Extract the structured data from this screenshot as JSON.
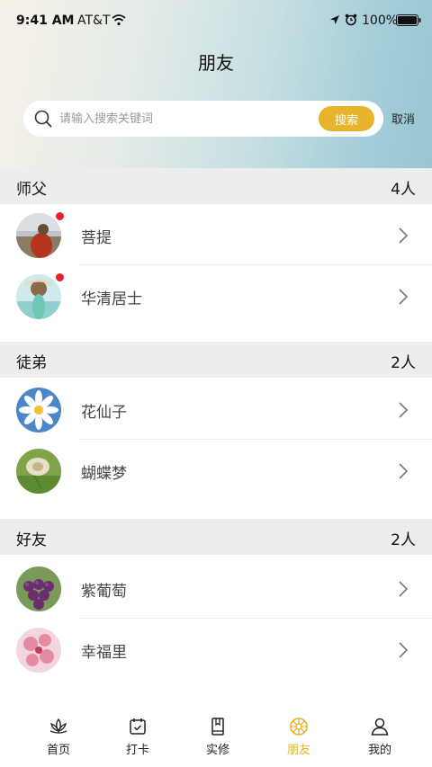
{
  "status_bar": {
    "time": "9:41 AM",
    "carrier": "AT&T",
    "battery": "100%"
  },
  "header": {
    "title": "朋友"
  },
  "search": {
    "placeholder": "请输入搜索关键词",
    "button_label": "搜索",
    "cancel_label": "取消"
  },
  "sections": [
    {
      "title": "师父",
      "count": "4人",
      "items": [
        {
          "name": "菩提",
          "unread": true
        },
        {
          "name": "华清居士",
          "unread": true
        }
      ]
    },
    {
      "title": "徒弟",
      "count": "2人",
      "items": [
        {
          "name": "花仙子",
          "unread": false
        },
        {
          "name": "蝴蝶梦",
          "unread": false
        }
      ]
    },
    {
      "title": "好友",
      "count": "2人",
      "items": [
        {
          "name": "紫葡萄",
          "unread": false
        },
        {
          "name": "幸福里",
          "unread": false
        }
      ]
    }
  ],
  "tab_bar": {
    "tabs": [
      {
        "label": "首页",
        "icon": "lotus-icon"
      },
      {
        "label": "打卡",
        "icon": "calendar-check-icon"
      },
      {
        "label": "实修",
        "icon": "book-icon"
      },
      {
        "label": "朋友",
        "icon": "dharma-wheel-icon",
        "active": true
      },
      {
        "label": "我的",
        "icon": "user-icon"
      }
    ]
  },
  "colors": {
    "accent": "#e6b52c",
    "badge": "#e4242a",
    "section_bg": "#ededed"
  }
}
